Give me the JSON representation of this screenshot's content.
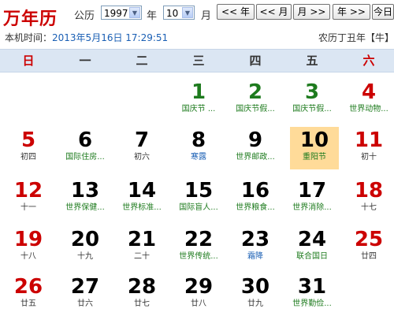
{
  "header": {
    "logo": "万年历",
    "calendar_type_label": "公历",
    "year_select": "1997",
    "year_label": "年",
    "month_select": "10",
    "month_label": "月",
    "prev_year_btn": "<< 年",
    "prev_month_btn": "<< 月",
    "next_month_btn": "月 >>",
    "next_year_btn": "年 >>",
    "today_btn": "今日",
    "local_time_label": "本机时间：",
    "local_time": "2013年5月16日 17:29:51",
    "lunar_year": "农历丁丑年【牛】"
  },
  "weekdays": [
    "日",
    "一",
    "二",
    "三",
    "四",
    "五",
    "六"
  ],
  "colors": {
    "red": "#cc0000",
    "green": "#1e7b1e",
    "blue": "#1a5fb4",
    "today_bg": "#ffdb99",
    "weekbar_bg": "#dbe6f3"
  },
  "days": [
    {
      "num": "1",
      "sub": "国庆节 ..."
    },
    {
      "num": "2",
      "sub": "国庆节假..."
    },
    {
      "num": "3",
      "sub": "国庆节假..."
    },
    {
      "num": "4",
      "sub": "世界动物..."
    },
    {
      "num": "5",
      "sub": "初四"
    },
    {
      "num": "6",
      "sub": "国际住房..."
    },
    {
      "num": "7",
      "sub": "初六"
    },
    {
      "num": "8",
      "sub": "寒露"
    },
    {
      "num": "9",
      "sub": "世界邮政..."
    },
    {
      "num": "10",
      "sub": "重阳节"
    },
    {
      "num": "11",
      "sub": "初十"
    },
    {
      "num": "12",
      "sub": "十一"
    },
    {
      "num": "13",
      "sub": "世界保健..."
    },
    {
      "num": "14",
      "sub": "世界标准..."
    },
    {
      "num": "15",
      "sub": "国际盲人..."
    },
    {
      "num": "16",
      "sub": "世界粮食..."
    },
    {
      "num": "17",
      "sub": "世界消除..."
    },
    {
      "num": "18",
      "sub": "十七"
    },
    {
      "num": "19",
      "sub": "十八"
    },
    {
      "num": "20",
      "sub": "十九"
    },
    {
      "num": "21",
      "sub": "二十"
    },
    {
      "num": "22",
      "sub": "世界传统..."
    },
    {
      "num": "23",
      "sub": "霜降"
    },
    {
      "num": "24",
      "sub": "联合国日"
    },
    {
      "num": "25",
      "sub": "廿四"
    },
    {
      "num": "26",
      "sub": "廿五"
    },
    {
      "num": "27",
      "sub": "廿六"
    },
    {
      "num": "28",
      "sub": "廿七"
    },
    {
      "num": "29",
      "sub": "廿八"
    },
    {
      "num": "30",
      "sub": "廿九"
    },
    {
      "num": "31",
      "sub": "世界勤俭..."
    }
  ]
}
